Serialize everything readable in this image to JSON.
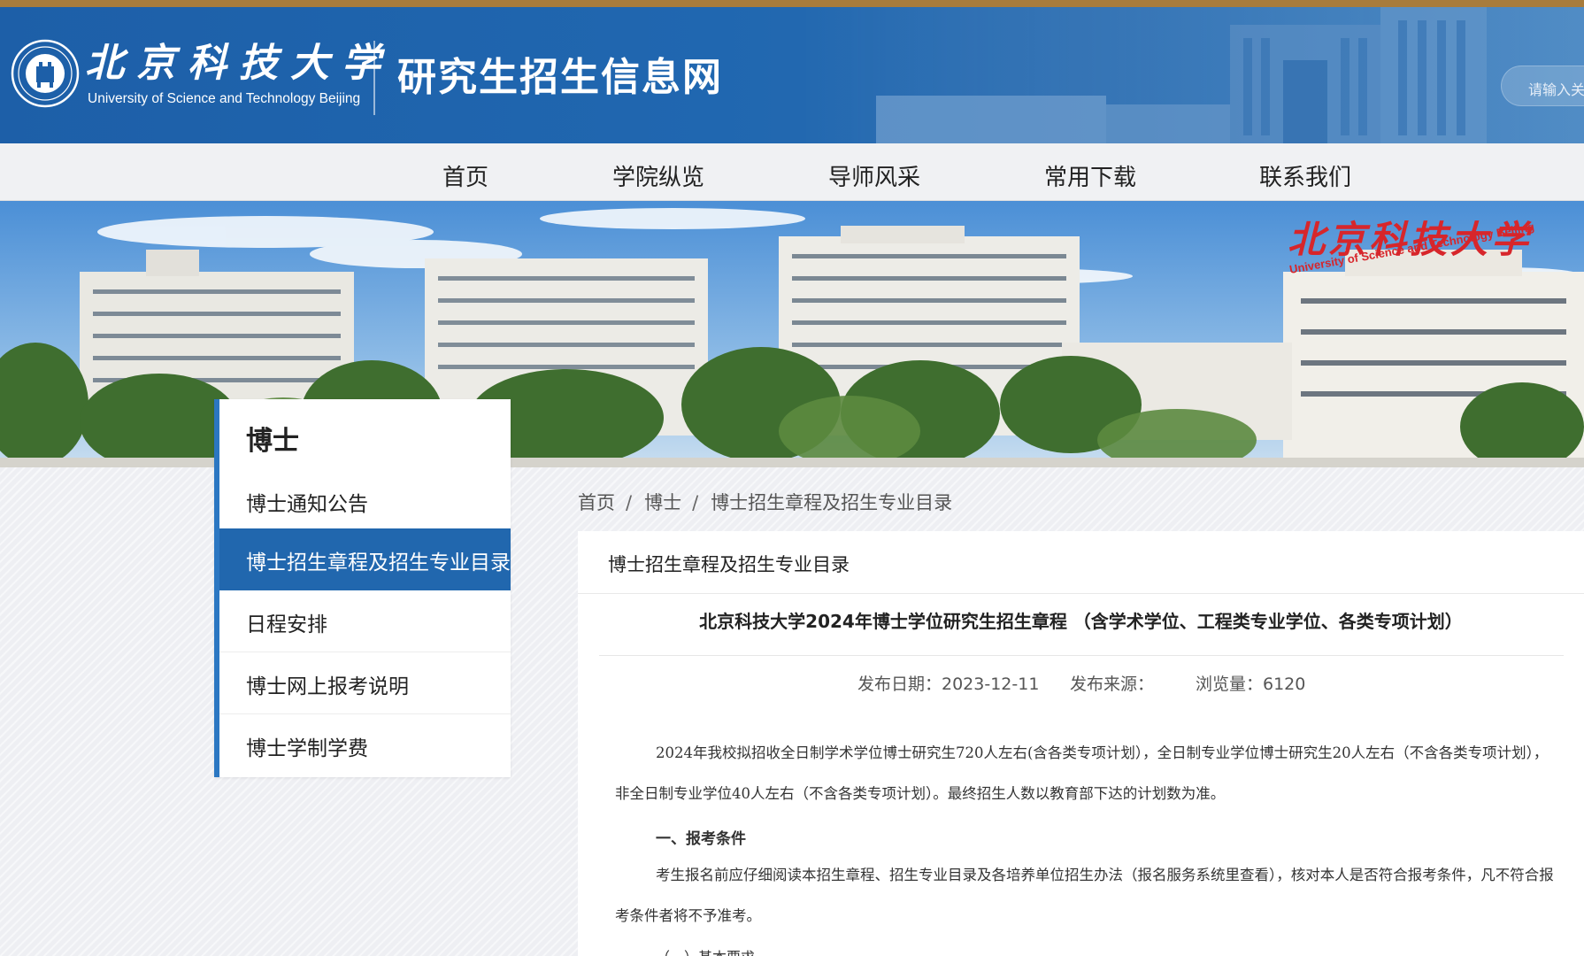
{
  "header": {
    "logo_cn": "北京科技大学",
    "logo_en": "University of Science and Technology Beijing",
    "site_title": "研究生招生信息网",
    "search_placeholder": "请输入关"
  },
  "nav": {
    "items": [
      {
        "label": "首页"
      },
      {
        "label": "学院纵览"
      },
      {
        "label": "导师风采"
      },
      {
        "label": "常用下载"
      },
      {
        "label": "联系我们"
      }
    ]
  },
  "banner": {
    "sign_cn": "北京科技大学",
    "sign_en": "University of Science and Technology Beijing"
  },
  "sidebar": {
    "title": "博士",
    "items": [
      {
        "label": "博士通知公告"
      },
      {
        "label": "博士招生章程及招生专业目录",
        "active": true
      },
      {
        "label": "日程安排"
      },
      {
        "label": "博士网上报考说明"
      },
      {
        "label": "博士学制学费"
      }
    ]
  },
  "breadcrumb": {
    "items": [
      "首页",
      "博士",
      "博士招生章程及招生专业目录"
    ],
    "separator": "/"
  },
  "content": {
    "section_title": "博士招生章程及招生专业目录",
    "article_title": "北京科技大学2024年博士学位研究生招生章程 （含学术学位、工程类专业学位、各类专项计划）",
    "meta": {
      "date": "发布日期：2023-12-11",
      "source": "发布来源：",
      "views": "浏览量：6120"
    },
    "paragraphs": [
      "2024年我校拟招收全日制学术学位博士研究生720人左右(含各类专项计划），全日制专业学位博士研究生20人左右（不含各类专项计划），非全日制专业学位40人左右（不含各类专项计划）。最终招生人数以教育部下达的计划数为准。",
      "考生报名前应仔细阅读本招生章程、招生专业目录及各培养单位招生办法（报名服务系统里查看），核对本人是否符合报考条件，凡不符合报考条件者将不予准考。"
    ],
    "heading1": "一、报考条件",
    "cut_heading": "（一）基本要求"
  }
}
